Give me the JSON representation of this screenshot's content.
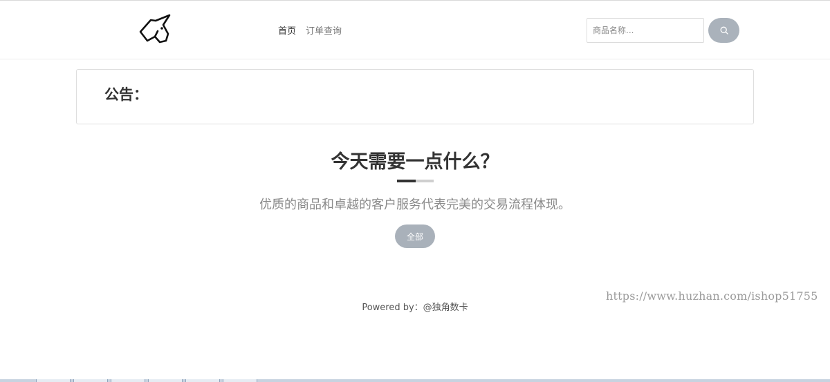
{
  "header": {
    "logo_icon": "unicorn-icon",
    "nav": [
      {
        "label": "首页"
      },
      {
        "label": "订单查询"
      }
    ],
    "search": {
      "placeholder": "商品名称...",
      "value": "",
      "button_icon": "search-icon"
    }
  },
  "notice": {
    "title": "公告："
  },
  "hero": {
    "title": "今天需要一点什么？",
    "subtitle": "优质的商品和卓越的客户服务代表完美的交易流程体现。",
    "category_button": "全部"
  },
  "footer": {
    "text": "Powered by：@独角数卡"
  },
  "watermark": {
    "text": "https://www.huzhan.com/ishop51755"
  },
  "colors": {
    "accent_button": "#a9b1ba",
    "text_dark": "#333333",
    "text_muted": "#8a8a8a"
  }
}
